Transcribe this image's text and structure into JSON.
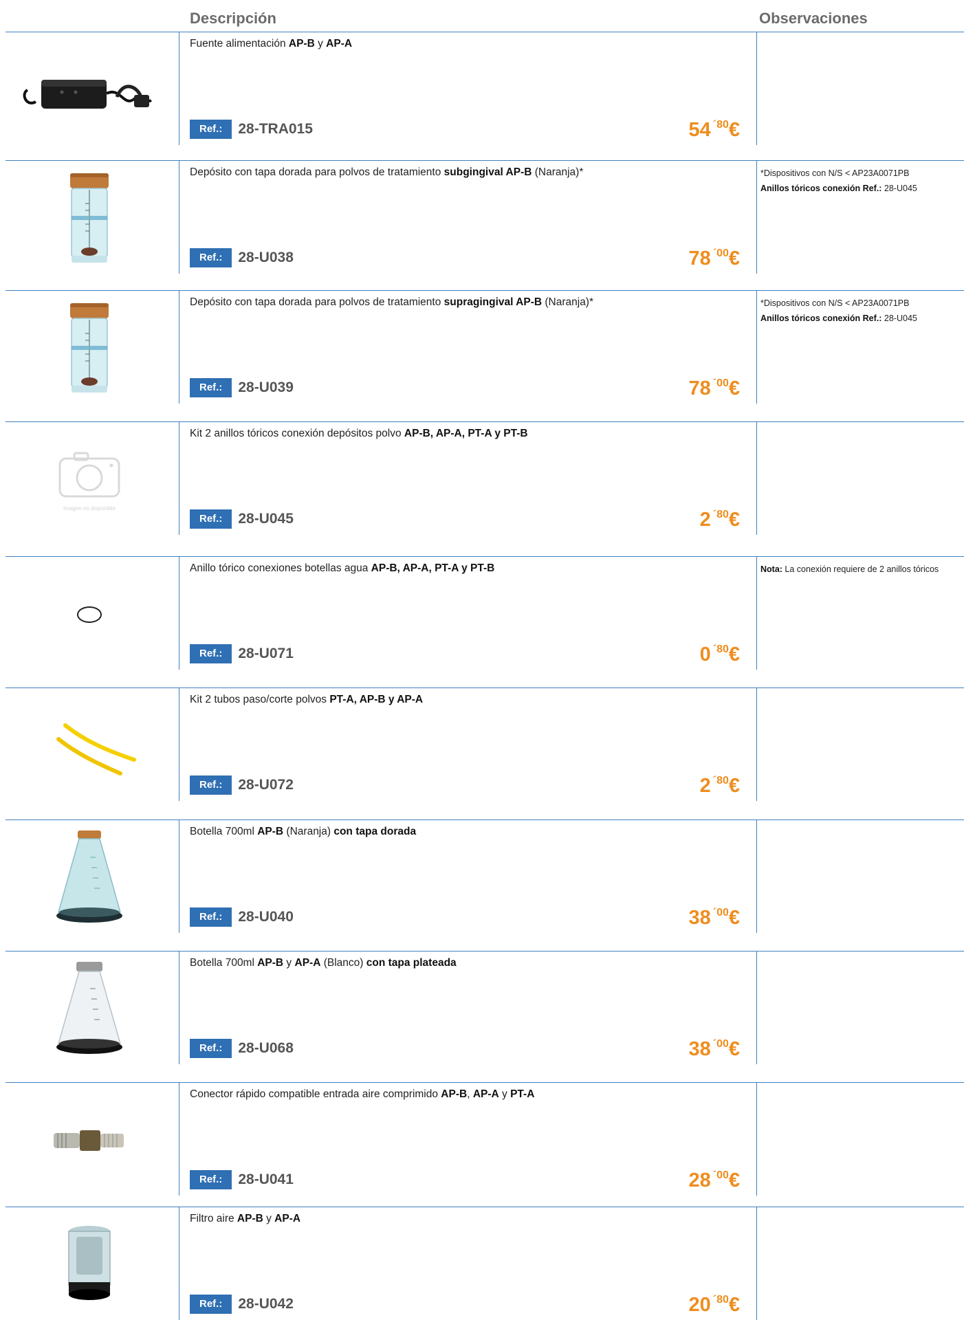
{
  "header": {
    "description": "Descripción",
    "observations": "Observaciones"
  },
  "ref_label": "Ref.:",
  "rows": [
    {
      "image": "power-supply",
      "desc": [
        [
          "Fuente alimentación ",
          false
        ],
        [
          "AP-B",
          true
        ],
        [
          " y ",
          false
        ],
        [
          "AP-A",
          true
        ]
      ],
      "ref": "28-TRA015",
      "price_int": "54",
      "price_dec": "´80",
      "currency": "€",
      "obs": []
    },
    {
      "image": "powder-container",
      "desc": [
        [
          "Depósito con tapa dorada para polvos de tratamiento ",
          false
        ],
        [
          "subgingival AP-B",
          true
        ],
        [
          " (Naranja)*",
          false
        ]
      ],
      "ref": "28-U038",
      "price_int": "78",
      "price_dec": "´00",
      "currency": "€",
      "obs": [
        [
          [
            "*Dispositivos con N/S < AP23A0071PB",
            false
          ]
        ],
        [
          [
            "Anillos tóricos conexión Ref.:",
            true
          ],
          [
            " 28-U045",
            false
          ]
        ]
      ]
    },
    {
      "image": "powder-container",
      "desc": [
        [
          "Depósito con tapa dorada para polvos de tratamiento ",
          false
        ],
        [
          "supragingival AP-B",
          true
        ],
        [
          " (Naranja)*",
          false
        ]
      ],
      "ref": "28-U039",
      "price_int": "78",
      "price_dec": "´00",
      "currency": "€",
      "obs": [
        [
          [
            "*Dispositivos con N/S < AP23A0071PB",
            false
          ]
        ],
        [
          [
            "Anillos tóricos conexión Ref.:",
            true
          ],
          [
            " 28-U045",
            false
          ]
        ]
      ]
    },
    {
      "image": "no-image",
      "no_image_text": "Imagen no disponible",
      "desc": [
        [
          "Kit 2 anillos tóricos conexión depósitos polvo  ",
          false
        ],
        [
          "AP-B, AP-A, PT-A y PT-B",
          true
        ]
      ],
      "ref": "28-U045",
      "price_int": "2",
      "price_dec": "´80",
      "currency": "€",
      "obs": []
    },
    {
      "image": "o-ring",
      "desc": [
        [
          "Anillo tórico conexiones botellas agua  ",
          false
        ],
        [
          "AP-B, AP-A, PT-A y PT-B",
          true
        ]
      ],
      "ref": "28-U071",
      "price_int": "0",
      "price_dec": "´80",
      "currency": "€",
      "obs": [
        [
          [
            "Nota:",
            true
          ],
          [
            " La conexión requiere de 2 anillos tóricos",
            false
          ]
        ]
      ]
    },
    {
      "image": "tubes",
      "desc": [
        [
          "Kit 2 tubos paso/corte polvos  ",
          false
        ],
        [
          "PT-A, AP-B y AP-A",
          true
        ]
      ],
      "ref": "28-U072",
      "price_int": "2",
      "price_dec": "´80",
      "currency": "€",
      "obs": []
    },
    {
      "image": "bottle-gold",
      "desc": [
        [
          "Botella 700ml ",
          false
        ],
        [
          "AP-B",
          true
        ],
        [
          " (Naranja) ",
          false
        ],
        [
          "con tapa dorada",
          true
        ]
      ],
      "ref": "28-U040",
      "price_int": "38",
      "price_dec": "´00",
      "currency": "€",
      "obs": []
    },
    {
      "image": "bottle-silver",
      "desc": [
        [
          "Botella 700ml ",
          false
        ],
        [
          "AP-B",
          true
        ],
        [
          " y ",
          false
        ],
        [
          "AP-A",
          true
        ],
        [
          " (Blanco) ",
          false
        ],
        [
          "con tapa plateada",
          true
        ]
      ],
      "ref": "28-U068",
      "price_int": "38",
      "price_dec": "´00",
      "currency": "€",
      "obs": []
    },
    {
      "image": "connector",
      "desc": [
        [
          "Conector rápido compatible entrada aire comprimido ",
          false
        ],
        [
          "AP-B",
          true
        ],
        [
          ", ",
          false
        ],
        [
          "AP-A",
          true
        ],
        [
          " y ",
          false
        ],
        [
          "PT-A",
          true
        ]
      ],
      "ref": "28-U041",
      "price_int": "28",
      "price_dec": "´00",
      "currency": "€",
      "obs": []
    },
    {
      "image": "air-filter",
      "desc": [
        [
          "Filtro aire ",
          false
        ],
        [
          "AP-B",
          true
        ],
        [
          " y ",
          false
        ],
        [
          "AP-A",
          true
        ]
      ],
      "ref": "28-U042",
      "price_int": "20",
      "price_dec": "´80",
      "currency": "€",
      "obs": []
    }
  ]
}
